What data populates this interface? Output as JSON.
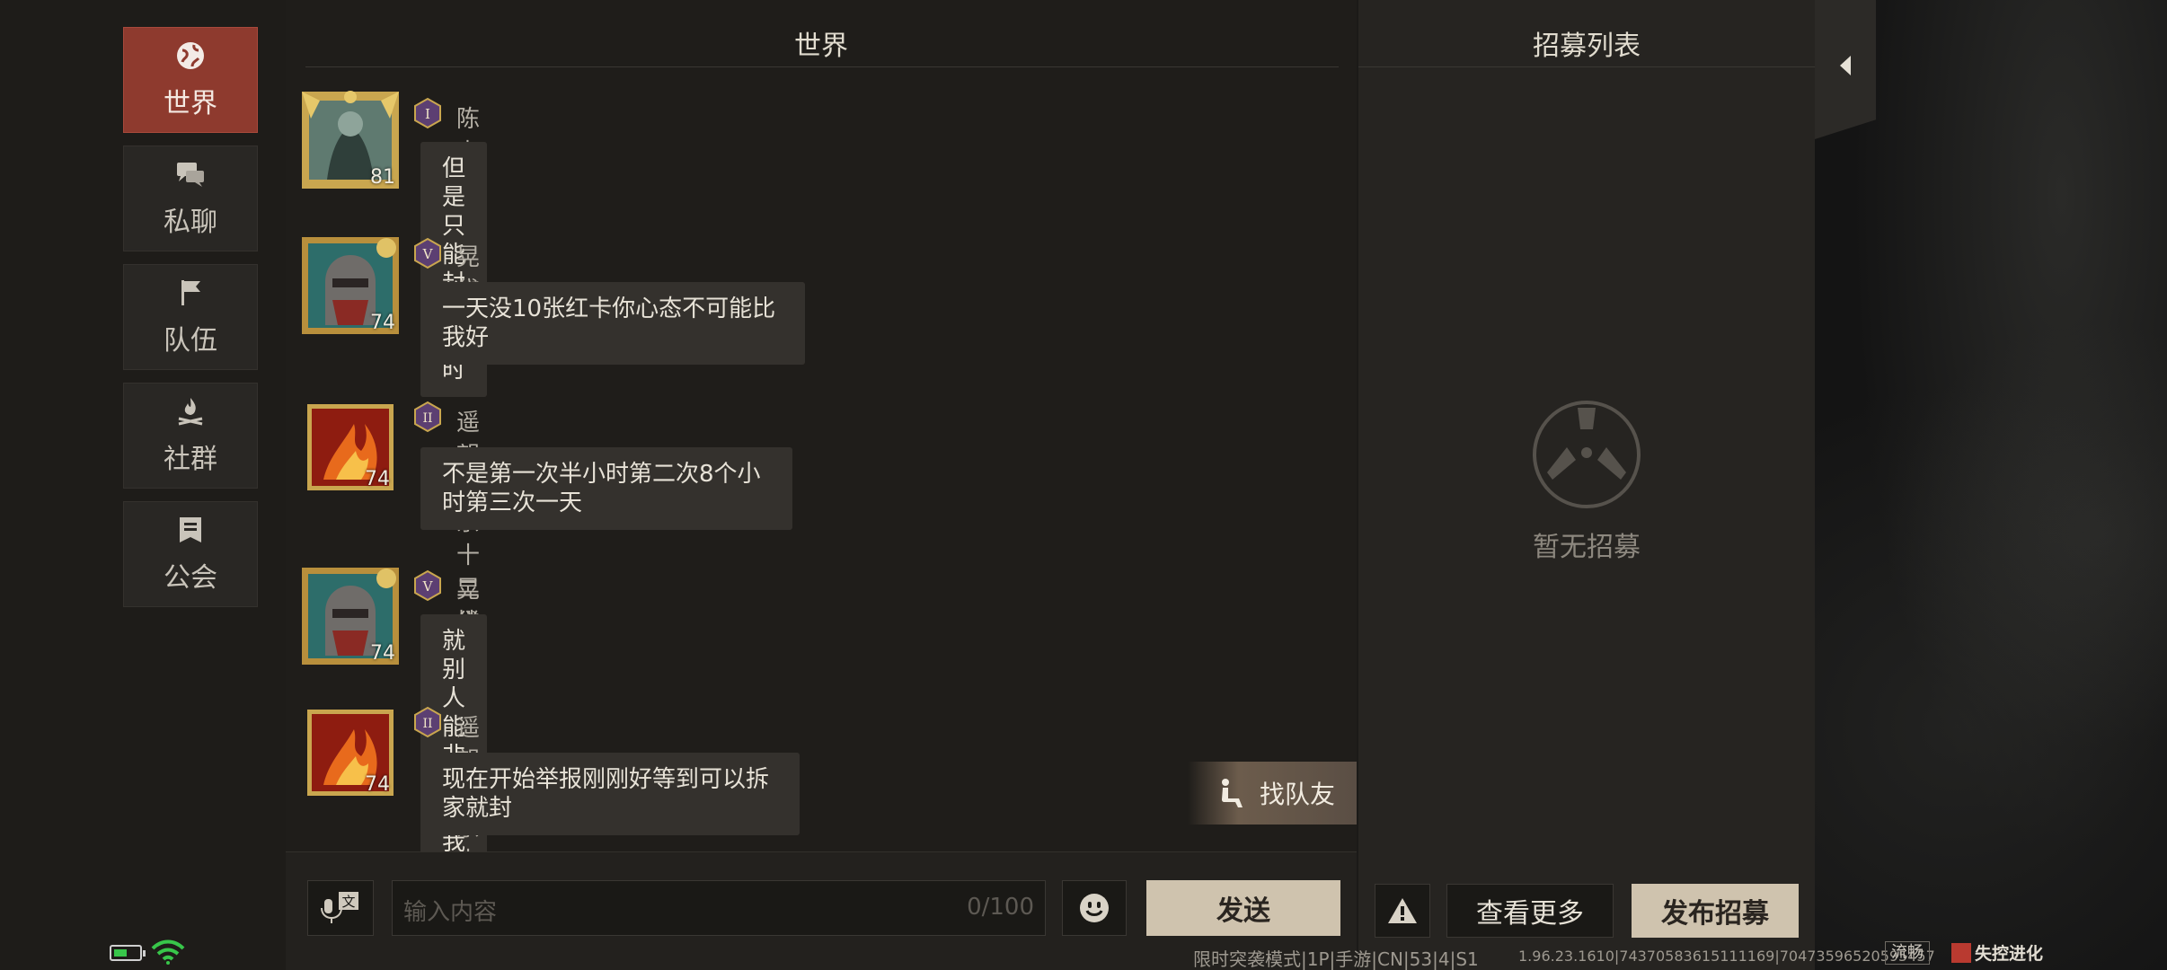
{
  "sidebar": {
    "items": [
      {
        "label": "世界",
        "icon": "globe-icon",
        "active": true
      },
      {
        "label": "私聊",
        "icon": "chat-bubbles-icon",
        "active": false
      },
      {
        "label": "队伍",
        "icon": "flag-icon",
        "active": false
      },
      {
        "label": "社群",
        "icon": "campfire-icon",
        "active": false
      },
      {
        "label": "公会",
        "icon": "guild-banner-icon",
        "active": false
      }
    ]
  },
  "chat": {
    "title": "世界",
    "messages": [
      {
        "name": "陈卡安",
        "rank": "I",
        "level": "81",
        "text": "但是只能封半小时"
      },
      {
        "name": "晃袋",
        "rank": "V",
        "level": "74",
        "text": "一天没10张红卡你心态不可能比我好"
      },
      {
        "name": "遥望玉京十二楼7",
        "rank": "II",
        "level": "74",
        "text": "不是第一次半小时第二次8个小时第三次一天"
      },
      {
        "name": "晃袋",
        "rank": "V",
        "level": "74",
        "text": "就别人能非法打我们我们不能"
      },
      {
        "name": "遥望玉京十二楼7",
        "rank": "II",
        "level": "74",
        "text": "现在开始举报刚刚好等到可以拆家就封"
      }
    ],
    "find_teammate_label": "找队友",
    "input_placeholder": "输入内容",
    "input_counter": "0/100",
    "send_label": "发送"
  },
  "recruit": {
    "title": "招募列表",
    "empty_text": "暂无招募",
    "more_label": "查看更多",
    "publish_label": "发布招募"
  },
  "status": {
    "mode_text": "限时突袭模式|1P|手游|CN|53|4|S1",
    "build_text": "1.96.23.1610|74370583615111169|70473596520595457",
    "network_label": "流畅",
    "game_logo_text": "失控进化"
  },
  "colors": {
    "active_tab": "#8e3a2e",
    "primary_button": "#cfc3ae",
    "panel": "#1f1d1a"
  }
}
